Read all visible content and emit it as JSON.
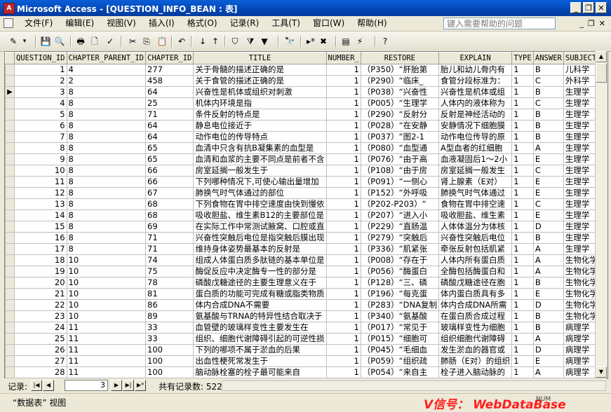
{
  "window": {
    "title": "Microsoft Access - [QUESTION_INFO_BEAN : 表]",
    "app_icon": "A"
  },
  "window_controls": {
    "minimize": "_",
    "restore": "❐",
    "close": "✕"
  },
  "menu": {
    "items": [
      "文件(F)",
      "编辑(E)",
      "视图(V)",
      "插入(I)",
      "格式(O)",
      "记录(R)",
      "工具(T)",
      "窗口(W)",
      "帮助(H)"
    ],
    "help_placeholder": "键入需要帮助的问题",
    "mdi": [
      "_",
      "❐",
      "✕"
    ]
  },
  "toolbar": {
    "icons": [
      "design-view-icon",
      "dropdown-arrow-icon",
      "save-icon",
      "search-icon",
      "print-icon",
      "print-preview-icon",
      "spelling-icon",
      "cut-icon",
      "copy-icon",
      "paste-icon",
      "undo-icon",
      "sort-ascending-icon",
      "sort-descending-icon",
      "filter-by-selection-icon",
      "filter-by-form-icon",
      "apply-filter-icon",
      "find-icon",
      "new-record-icon",
      "delete-record-icon",
      "database-window-icon",
      "new-object-icon",
      "help-icon"
    ],
    "glyphs": [
      "✎",
      "▾",
      "💾",
      "🔍",
      "🖶",
      "🗋",
      "✓",
      "✂",
      "⎘",
      "📋",
      "↶",
      "↓",
      "↑",
      "⛉",
      "⧩",
      "▼",
      "🔭",
      "▸*",
      "✖",
      "▤",
      "⚡",
      "?"
    ]
  },
  "grid": {
    "columns": [
      "QUESTION_ID",
      "CHAPTER_PARENT_ID",
      "CHAPTER_ID",
      "TITLE",
      "NUMBER_",
      "RESTORE",
      "EXPLAIN",
      "TYPE",
      "ANSWER",
      "SUBJECT_N"
    ],
    "current_row_index": 2,
    "current_marker": "▶",
    "rows": [
      [
        "1",
        "4",
        "277",
        "关于骨髓的描述正确的是",
        "1",
        "（P350）“肝胎第",
        "胎儿和幼儿骨内有",
        "1",
        "B",
        "儿科学"
      ],
      [
        "2",
        "2",
        "458",
        "关于食管的描述正确的是",
        "1",
        "（P290）“临床_",
        "食管分段标准为：",
        "1",
        "C",
        "外科学"
      ],
      [
        "3",
        "8",
        "64",
        "兴奋性是机体或组织对刺激",
        "1",
        "（P038）“兴奋性",
        "兴奋性是机体或组",
        "1",
        "B",
        "生理学"
      ],
      [
        "4",
        "8",
        "25",
        "机体内环境是指",
        "1",
        "（P005）“生理学",
        "人体内的液体称为",
        "1",
        "C",
        "生理学"
      ],
      [
        "5",
        "8",
        "71",
        "条件反射的特点是",
        "1",
        "（P290）“反射分",
        "反射是神经活动的",
        "1",
        "B",
        "生理学"
      ],
      [
        "6",
        "8",
        "64",
        "静息电位接近于",
        "1",
        "（P028）“在安静",
        "安静情况下细胞膜",
        "1",
        "B",
        "生理学"
      ],
      [
        "7",
        "8",
        "64",
        "动作电位的传导特点",
        "1",
        "（P037）“图2-1",
        "动作电位传导的原",
        "1",
        "B",
        "生理学"
      ],
      [
        "8",
        "8",
        "65",
        "血清中只含有抗B凝集素的血型是",
        "1",
        "（P080）“血型通",
        "A型血者的红细胞",
        "1",
        "A",
        "生理学"
      ],
      [
        "9",
        "8",
        "65",
        "血清和血浆的主要不同点是前者不含",
        "1",
        "（P076）“由于高",
        "血液凝固后1～2小",
        "1",
        "E",
        "生理学"
      ],
      [
        "10",
        "8",
        "66",
        "房室延搁一般发生于",
        "1",
        "（P108）“由于房",
        "房室延搁一般发生",
        "1",
        "C",
        "生理学"
      ],
      [
        "11",
        "8",
        "66",
        "下列哪种情况下,可使心输出量增加",
        "1",
        "（P091）“一侧心",
        "肾上腺素（E对）",
        "1",
        "E",
        "生理学"
      ],
      [
        "12",
        "8",
        "67",
        "肺换气时气体通过的部位",
        "1",
        "（P152）“外呼吸",
        "肺换气时气体通过",
        "1",
        "E",
        "生理学"
      ],
      [
        "13",
        "8",
        "68",
        "下列食物在胃中排空速度由快到慢依",
        "1",
        "（P202-P203）“",
        "食物在胃中排空速",
        "1",
        "C",
        "生理学"
      ],
      [
        "14",
        "8",
        "68",
        "吸收胆盐、维生素B12的主要部位是",
        "1",
        "（P207）“进入小",
        "吸收胆盐、维生素",
        "1",
        "E",
        "生理学"
      ],
      [
        "15",
        "8",
        "69",
        "在实际工作中常测试腋窝、口腔或直",
        "1",
        "（P229）“直肠温",
        "人体体温分为体核",
        "1",
        "D",
        "生理学"
      ],
      [
        "16",
        "8",
        "71",
        "兴奋性突触后电位是指突触后膜出现",
        "1",
        "（P279）“突触后",
        "兴奋性突触后电位",
        "1",
        "B",
        "生理学"
      ],
      [
        "17",
        "8",
        "71",
        "维持身体姿势最基本的反射是",
        "1",
        "（P336）“肌紧张",
        "牵张反射包括肌紧",
        "1",
        "A",
        "生理学"
      ],
      [
        "18",
        "10",
        "74",
        "组成人体蛋白质多肽链的基本单位是",
        "1",
        "（P008）“存在于",
        "人体内所有蛋白质",
        "1",
        "A",
        "生物化学"
      ],
      [
        "19",
        "10",
        "75",
        "酶促反应中决定酶专一性的部分是",
        "1",
        "（P056）“酶蛋白",
        "全酶包括酶蛋白和",
        "1",
        "A",
        "生物化学"
      ],
      [
        "20",
        "10",
        "78",
        "磷酸戊糖途径的主要生理意义在于",
        "1",
        "（P128）“三、磷",
        "磷酸戊糖途径在胞",
        "1",
        "B",
        "生物化学"
      ],
      [
        "21",
        "10",
        "81",
        "蛋白质的功能可完成有糖或脂类物质",
        "1",
        "（P196）“每克蛋",
        "体内蛋白质具有多",
        "1",
        "E",
        "生物化学"
      ],
      [
        "22",
        "10",
        "86",
        "体内合成DNA不需要",
        "1",
        "（P283）“DNA复制",
        "体内合成DNA所需",
        "1",
        "D",
        "生物化学"
      ],
      [
        "23",
        "10",
        "89",
        "氨基酸与TRNA的特异性结合取决于",
        "1",
        "（P340）“氨基酸",
        "在蛋白质合成过程",
        "1",
        "B",
        "生物化学"
      ],
      [
        "24",
        "11",
        "33",
        "血管壁的玻璃样变性主要发生在",
        "1",
        "（P017）“常见于",
        "玻璃样变性为细胞",
        "1",
        "B",
        "病理学"
      ],
      [
        "25",
        "11",
        "33",
        "组织、细胞代谢障碍引起的可逆性损",
        "1",
        "（P015）“细胞可",
        "组织细胞代谢障碍",
        "1",
        "A",
        "病理学"
      ],
      [
        "26",
        "11",
        "100",
        "下列的哪项不属于淤血的后果",
        "1",
        "（P045）“毛细血",
        "发生淤血的器官或",
        "1",
        "D",
        "病理学"
      ],
      [
        "27",
        "11",
        "100",
        "出血性梗死常发生于",
        "1",
        "（P059）“组织疏",
        "肺肠（E对）的组织",
        "1",
        "E",
        "病理学"
      ],
      [
        "28",
        "11",
        "100",
        "脑动脉栓塞的栓子最可能来自",
        "1",
        "（P054）“来自主",
        "栓子进入脑动脉的",
        "1",
        "A",
        "病理学"
      ]
    ]
  },
  "navigation": {
    "label": "记录:",
    "first": "|◀",
    "prev": "◀",
    "current": "3",
    "next": "▶",
    "last": "▶|",
    "new": "▶*",
    "count_text": "共有记录数: 5220"
  },
  "scrollbar": {
    "up": "▲",
    "down": "▼"
  },
  "status": {
    "text": "“数据表” 视图",
    "num": "NUM"
  },
  "watermark": "V信号： WebDataBase"
}
